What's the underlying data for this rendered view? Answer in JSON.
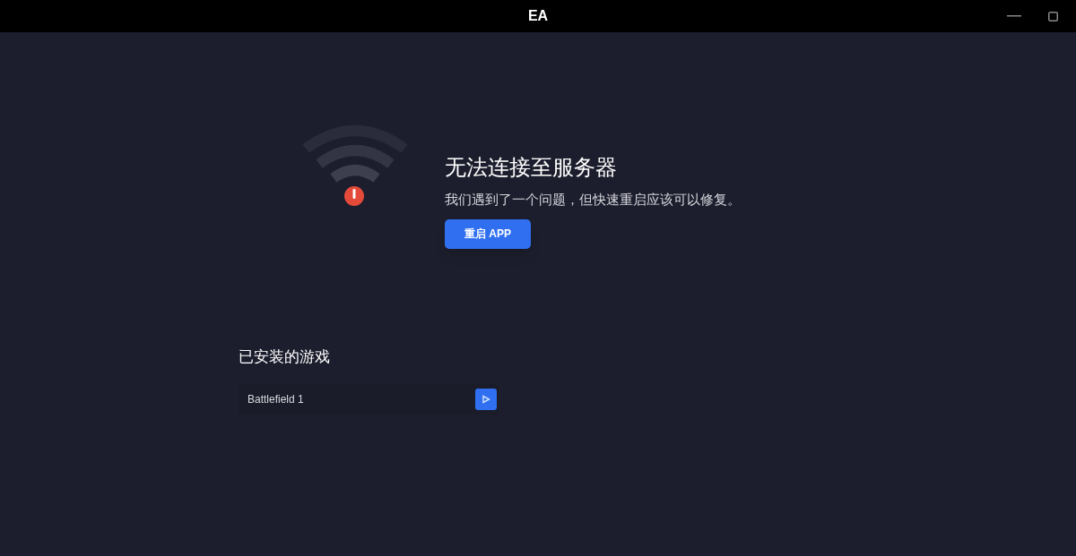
{
  "window": {
    "title": "EA"
  },
  "error": {
    "title": "无法连接至服务器",
    "message": "我们遇到了一个问题，但快速重启应该可以修复。",
    "button": "重启 APP"
  },
  "installed": {
    "heading": "已安装的游戏",
    "games": [
      {
        "name": "Battlefield 1"
      }
    ]
  }
}
